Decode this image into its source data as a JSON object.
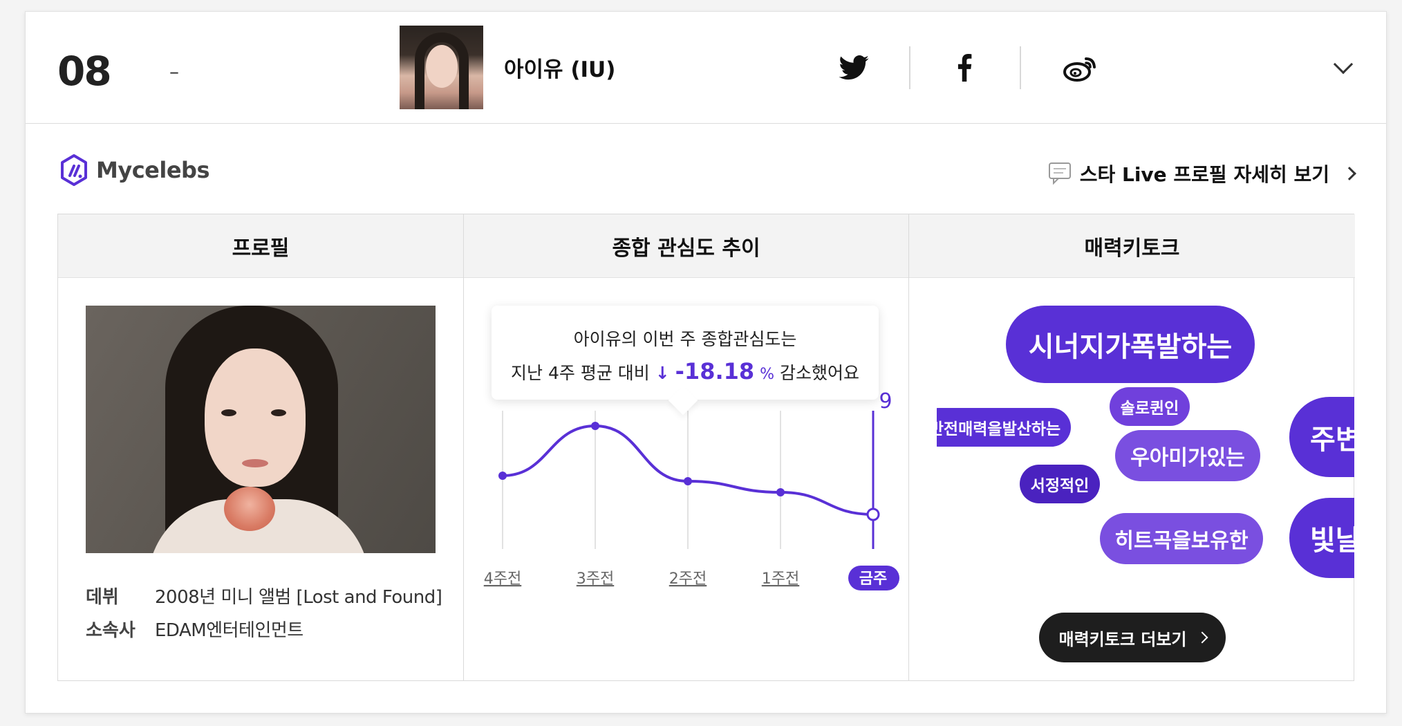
{
  "header": {
    "rank": "08",
    "rank_change": "–",
    "artist_name": "아이유 (IU)"
  },
  "social": {
    "icons": [
      "twitter-icon",
      "facebook-icon",
      "weibo-icon"
    ]
  },
  "brand": {
    "name": "Mycelebs"
  },
  "profile_link": {
    "label": "스타 Live 프로필 자세히 보기"
  },
  "panel": {
    "columns": [
      "프로필",
      "종합 관심도 추이",
      "매력키토크"
    ]
  },
  "profile": {
    "rows": [
      {
        "key": "데뷔",
        "value": "2008년 미니 앨범 [Lost and Found]"
      },
      {
        "key": "소속사",
        "value": "EDAM엔터테인먼트"
      }
    ]
  },
  "trend": {
    "line1": "아이유의 이번 주 종합관심도는",
    "line2_prefix": "지난 4주 평균 대비",
    "arrow": "↓",
    "percent": "-18.18",
    "unit": "%",
    "line2_suffix": "감소했어요",
    "current_value_label": "9"
  },
  "chart_data": {
    "type": "line",
    "categories": [
      "4주전",
      "3주전",
      "2주전",
      "1주전",
      "금주"
    ],
    "values": [
      9.7,
      10.6,
      9.6,
      9.4,
      9
    ],
    "highlighted_category": "금주",
    "grid": true,
    "color": "#5930d6"
  },
  "keywords": {
    "items": [
      {
        "text": "시너지가폭발하는",
        "variant": "large"
      },
      {
        "text": "솔로퀸인",
        "variant": "small"
      },
      {
        "text": "반전매력을발산하는",
        "variant": "small"
      },
      {
        "text": "우아미가있는",
        "variant": "medium"
      },
      {
        "text": "주변",
        "variant": "large"
      },
      {
        "text": "서정적인",
        "variant": "small"
      },
      {
        "text": "히트곡을보유한",
        "variant": "medium"
      },
      {
        "text": "빛날",
        "variant": "large"
      }
    ],
    "more_label": "매력키토크 더보기"
  },
  "colors": {
    "accent": "#5930d6",
    "accent_light": "#7a4fe0",
    "dark_button": "#1e1e1e"
  }
}
